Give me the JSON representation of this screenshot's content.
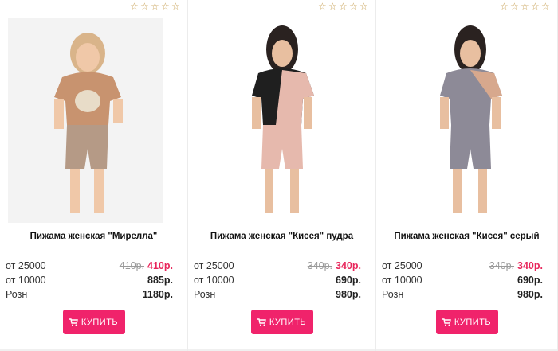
{
  "products": [
    {
      "title": "Пижама женская \"Мирелла\"",
      "rows": [
        {
          "label": "от 25000",
          "old": "410р.",
          "price": "410р."
        },
        {
          "label": "от 10000",
          "old": "",
          "price": "885р."
        },
        {
          "label": "Розн",
          "old": "",
          "price": "1180р."
        }
      ],
      "buy_label": "КУПИТЬ",
      "shirt_color": "#c8936f",
      "bg": "#f4f4f4"
    },
    {
      "title": "Пижама женская \"Кисея\" пудра",
      "rows": [
        {
          "label": "от 25000",
          "old": "340р.",
          "price": "340р."
        },
        {
          "label": "от 10000",
          "old": "",
          "price": "690р."
        },
        {
          "label": "Розн",
          "old": "",
          "price": "980р."
        }
      ],
      "buy_label": "КУПИТЬ",
      "shirt_color": "#e6b9ad",
      "bg": "#ffffff"
    },
    {
      "title": "Пижама женская \"Кисея\" серый",
      "rows": [
        {
          "label": "от 25000",
          "old": "340р.",
          "price": "340р."
        },
        {
          "label": "от 10000",
          "old": "",
          "price": "690р."
        },
        {
          "label": "Розн",
          "old": "",
          "price": "980р."
        }
      ],
      "buy_label": "КУПИТЬ",
      "shirt_color": "#8d8a97",
      "bg": "#ffffff"
    }
  ],
  "colors": {
    "accent": "#f0236b",
    "sale": "#e8265b",
    "star": "#c9a35a"
  },
  "icons": {
    "rating": "star-outline-icon",
    "buy": "cart-icon"
  }
}
